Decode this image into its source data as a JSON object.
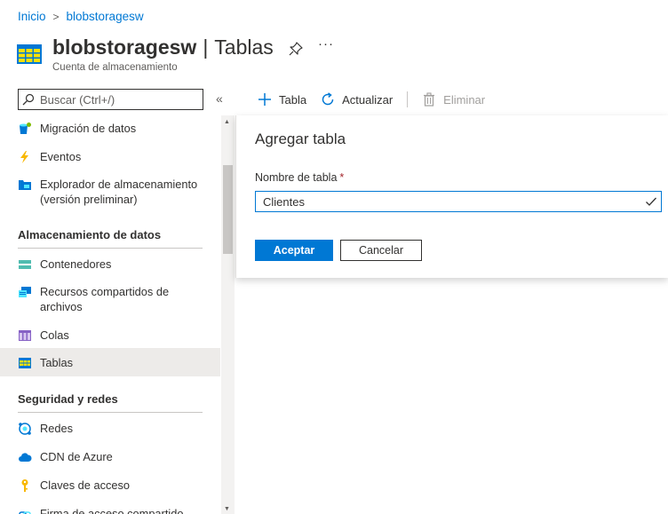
{
  "breadcrumb": {
    "home": "Inicio",
    "separator": ">",
    "current": "blobstoragesw"
  },
  "header": {
    "name": "blobstoragesw",
    "divider": "|",
    "section": "Tablas",
    "subtitle": "Cuenta de almacenamiento",
    "more": "···"
  },
  "search": {
    "placeholder": "Buscar (Ctrl+/)",
    "collapse": "«"
  },
  "sidebar": {
    "items_top": [
      {
        "label": "Migración de datos",
        "icon": "data-migration-icon"
      },
      {
        "label": "Eventos",
        "icon": "lightning-icon"
      },
      {
        "label": "Explorador de almacenamiento (versión preliminar)",
        "icon": "storage-explorer-icon"
      }
    ],
    "group_data": {
      "title": "Almacenamiento de datos",
      "items": [
        {
          "label": "Contenedores",
          "icon": "containers-icon"
        },
        {
          "label": "Recursos compartidos de archivos",
          "icon": "file-shares-icon"
        },
        {
          "label": "Colas",
          "icon": "queues-icon"
        },
        {
          "label": "Tablas",
          "icon": "tables-icon",
          "selected": true
        }
      ]
    },
    "group_security": {
      "title": "Seguridad y redes",
      "items": [
        {
          "label": "Redes",
          "icon": "networking-icon"
        },
        {
          "label": "CDN de Azure",
          "icon": "cloud-icon"
        },
        {
          "label": "Claves de acceso",
          "icon": "key-icon"
        },
        {
          "label": "Firma de acceso compartido",
          "icon": "link-icon"
        }
      ]
    }
  },
  "toolbar": {
    "add_table": "Tabla",
    "refresh": "Actualizar",
    "delete": "Eliminar"
  },
  "panel": {
    "title": "Agregar tabla",
    "field_label": "Nombre de tabla",
    "required_mark": "*",
    "field_value": "Clientes",
    "accept": "Aceptar",
    "cancel": "Cancelar"
  },
  "colors": {
    "accent": "#0078d4",
    "text": "#323130",
    "selected_bg": "#edebe9",
    "required": "#a4262c"
  }
}
